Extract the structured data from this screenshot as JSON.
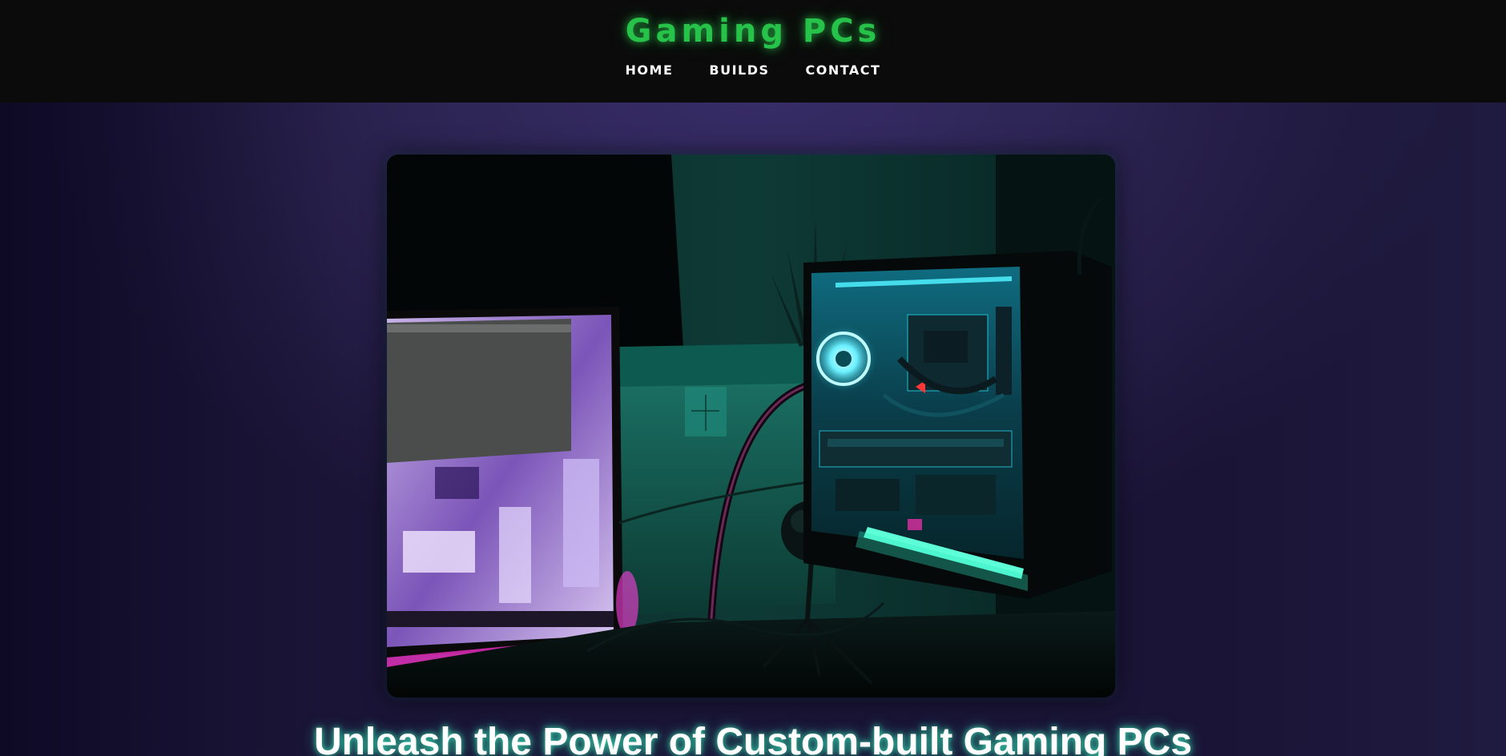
{
  "header": {
    "brand": "Gaming PCs",
    "nav": [
      {
        "label": "HOME"
      },
      {
        "label": "BUILDS"
      },
      {
        "label": "CONTACT"
      }
    ]
  },
  "hero": {
    "image_icon": "gaming-pc-setup-photo",
    "title": "Unleash the Power of Custom-built Gaming PCs"
  },
  "colors": {
    "header_bg": "#0b0b0b",
    "brand": "#27c24a",
    "page_bg": "#2d2554",
    "title_glow": "#3cffc8"
  }
}
